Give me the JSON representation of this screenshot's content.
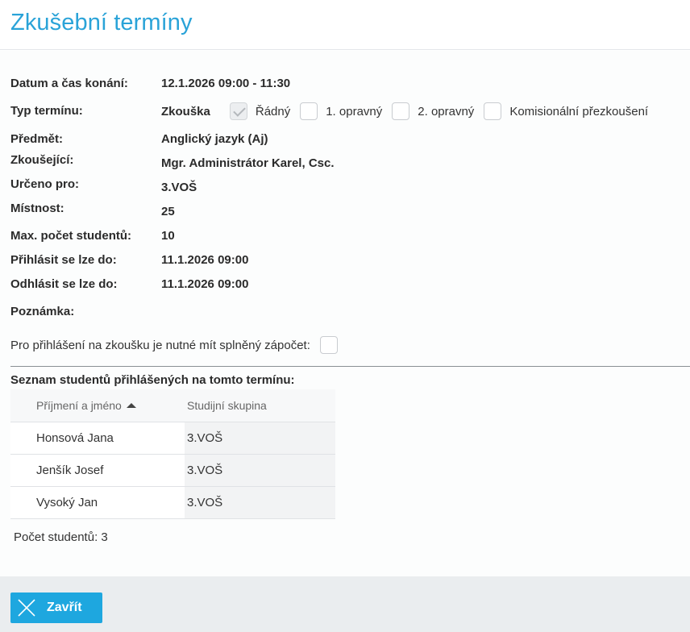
{
  "window": {
    "title": "Zkušební termíny"
  },
  "details": {
    "datetime_label": "Datum a čas konání:",
    "datetime_value": "12.1.2026 09:00 - 11:30",
    "type_label": "Typ termínu:",
    "type_value": "Zkouška",
    "type_options": [
      {
        "label": "Řádný",
        "checked": true
      },
      {
        "label": "1. opravný",
        "checked": false
      },
      {
        "label": "2. opravný",
        "checked": false
      },
      {
        "label": "Komisionální přezkoušení",
        "checked": false
      }
    ],
    "subject_label": "Předmět:",
    "subject_value": "Anglický jazyk (Aj)",
    "examiner_label": "Zkoušející:",
    "examiner_value": "Mgr. Administrátor Karel, Csc.",
    "intended_label": "Určeno pro:",
    "intended_value": "3.VOŠ",
    "room_label": "Místnost:",
    "room_value": "25",
    "max_label": "Max. počet studentů:",
    "max_value": "10",
    "signin_label": "Přihlásit se lze do:",
    "signin_value": "11.1.2026 09:00",
    "signout_label": "Odhlásit se lze do:",
    "signout_value": "11.1.2026 09:00",
    "note_label": "Poznámka:",
    "prerequisite_label": "Pro přihlášení na zkoušku je nutné mít splněný zápočet:",
    "prerequisite_checked": false
  },
  "students": {
    "title": "Seznam studentů přihlášených na tomto termínu:",
    "columns": [
      "Příjmení a jméno",
      "Studijní skupina"
    ],
    "sort_icon": "sort-ascending-icon",
    "rows": [
      {
        "name": "Honsová Jana",
        "group": "3.VOŠ"
      },
      {
        "name": "Jenšík Josef",
        "group": "3.VOŠ"
      },
      {
        "name": "Vysoký Jan",
        "group": "3.VOŠ"
      }
    ],
    "count_text": "Počet studentů: 3"
  },
  "footer": {
    "close_label": "Zavřít",
    "close_icon": "close-icon"
  },
  "colors": {
    "accent": "#1ea7df",
    "title": "#2aa3d8",
    "footer_bg": "#eaedef"
  }
}
